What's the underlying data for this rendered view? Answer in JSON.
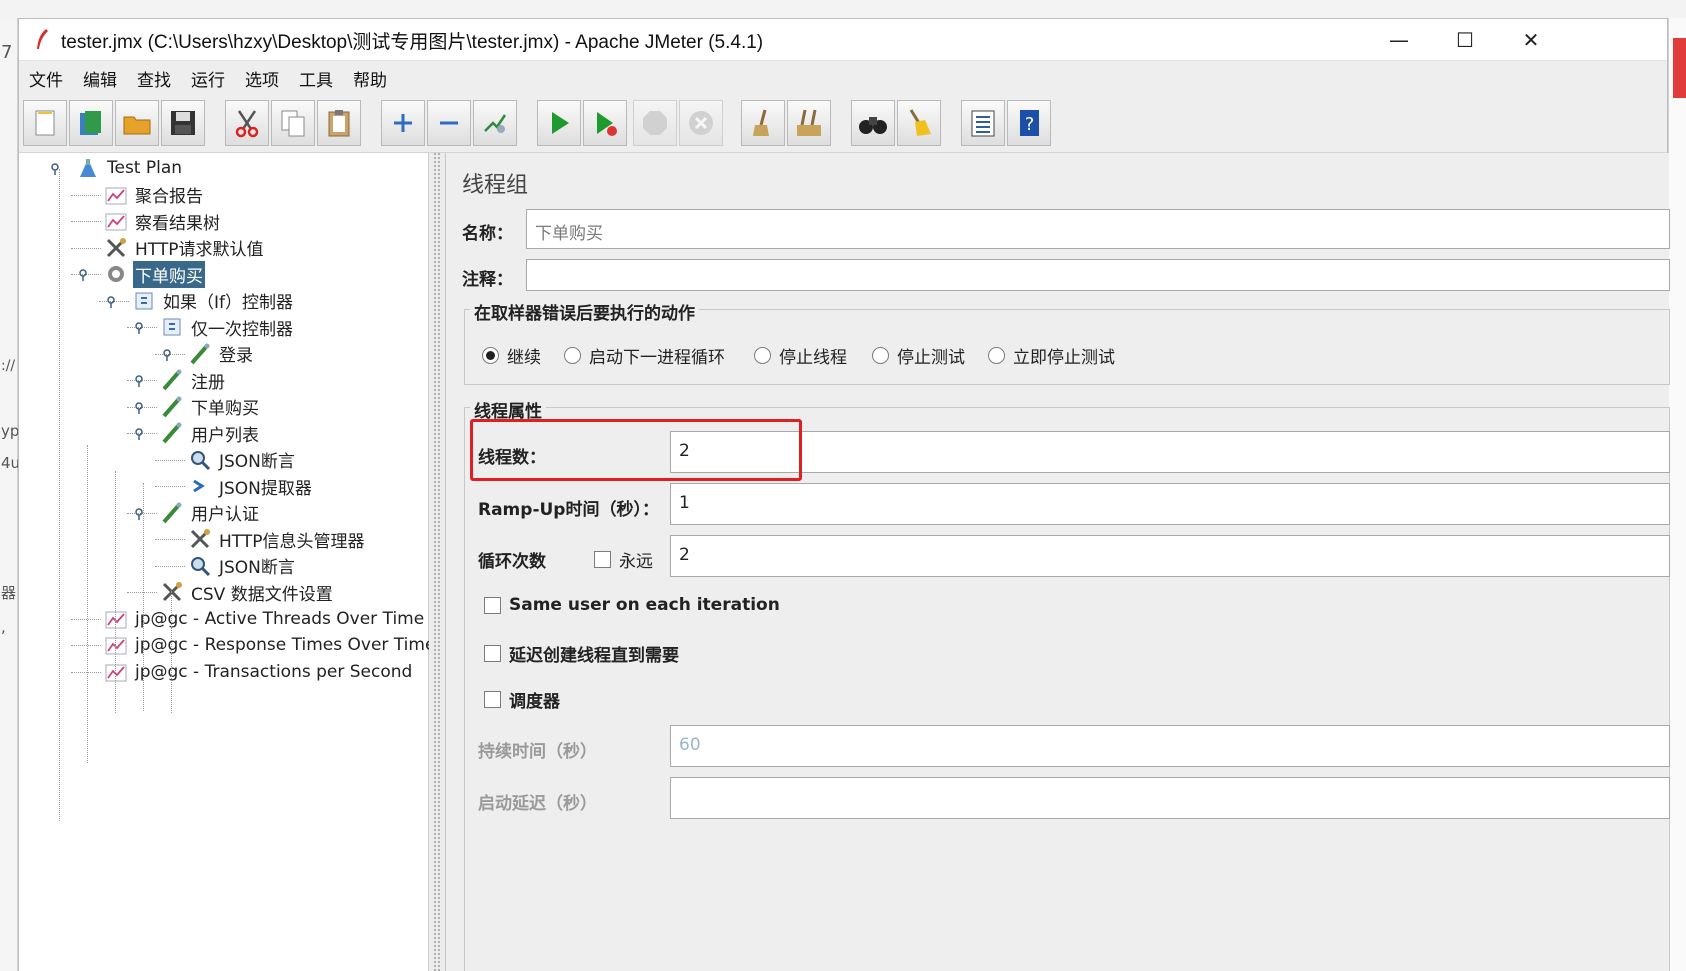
{
  "window": {
    "title": "tester.jmx (C:\\Users\\hzxy\\Desktop\\测试专用图片\\tester.jmx) - Apache JMeter (5.4.1)",
    "minimize": "—",
    "maximize": "☐",
    "close": "✕"
  },
  "background": {
    "left_chars": [
      "7",
      "://",
      "yp",
      "4u",
      "器",
      ","
    ]
  },
  "menu": [
    "文件",
    "编辑",
    "查找",
    "运行",
    "选项",
    "工具",
    "帮助"
  ],
  "toolbar": [
    {
      "icon": "new-icon"
    },
    {
      "icon": "templates-icon"
    },
    {
      "icon": "open-icon"
    },
    {
      "icon": "save-icon"
    },
    {
      "icon": "cut-icon"
    },
    {
      "icon": "copy-icon"
    },
    {
      "icon": "paste-icon"
    },
    {
      "icon": "expand-icon"
    },
    {
      "icon": "collapse-icon"
    },
    {
      "icon": "toggle-icon"
    },
    {
      "icon": "start-icon"
    },
    {
      "icon": "start-no-pauses-icon"
    },
    {
      "icon": "stop-icon"
    },
    {
      "icon": "shutdown-icon"
    },
    {
      "icon": "clear-icon"
    },
    {
      "icon": "clear-all-icon"
    },
    {
      "icon": "search-icon"
    },
    {
      "icon": "reset-search-icon"
    },
    {
      "icon": "function-helper-icon"
    },
    {
      "icon": "help-icon"
    }
  ],
  "tree": [
    {
      "label": "Test Plan",
      "icon": "test-plan-icon"
    },
    {
      "label": "聚合报告",
      "icon": "listener-icon"
    },
    {
      "label": "察看结果树",
      "icon": "listener-icon"
    },
    {
      "label": "HTTP请求默认值",
      "icon": "config-icon"
    },
    {
      "label": "下单购买",
      "icon": "thread-group-icon",
      "selected": true
    },
    {
      "label": "如果（If）控制器",
      "icon": "controller-icon"
    },
    {
      "label": "仅一次控制器",
      "icon": "controller-icon"
    },
    {
      "label": "登录",
      "icon": "sampler-icon"
    },
    {
      "label": "注册",
      "icon": "sampler-icon"
    },
    {
      "label": "下单购买",
      "icon": "sampler-icon"
    },
    {
      "label": "用户列表",
      "icon": "sampler-icon"
    },
    {
      "label": "JSON断言",
      "icon": "assertion-icon"
    },
    {
      "label": "JSON提取器",
      "icon": "extractor-icon"
    },
    {
      "label": "用户认证",
      "icon": "sampler-icon"
    },
    {
      "label": "HTTP信息头管理器",
      "icon": "config-icon"
    },
    {
      "label": "JSON断言",
      "icon": "assertion-icon"
    },
    {
      "label": "CSV 数据文件设置",
      "icon": "config-icon"
    },
    {
      "label": "jp@gc - Active Threads Over Time",
      "icon": "listener-icon"
    },
    {
      "label": "jp@gc - Response Times Over Time",
      "icon": "listener-icon"
    },
    {
      "label": "jp@gc - Transactions per Second",
      "icon": "listener-icon"
    }
  ],
  "panel": {
    "title": "线程组",
    "name_label": "名称：",
    "name_value": "下单购买",
    "comment_label": "注释：",
    "comment_value": "",
    "error_action_title": "在取样器错误后要执行的动作",
    "error_actions": [
      {
        "label": "继续",
        "checked": true
      },
      {
        "label": "启动下一进程循环",
        "checked": false
      },
      {
        "label": "停止线程",
        "checked": false
      },
      {
        "label": "停止测试",
        "checked": false
      },
      {
        "label": "立即停止测试",
        "checked": false
      }
    ],
    "thread_props_title": "线程属性",
    "threads_label": "线程数：",
    "threads_value": "2",
    "rampup_label": "Ramp-Up时间（秒）：",
    "rampup_value": "1",
    "loop_label": "循环次数",
    "forever_label": "永远",
    "loop_value": "2",
    "same_user_label": "Same user on each iteration",
    "delay_create_label": "延迟创建线程直到需要",
    "scheduler_label": "调度器",
    "duration_label": "持续时间（秒）",
    "duration_value": "60",
    "startup_delay_label": "启动延迟（秒）",
    "startup_delay_value": ""
  },
  "colors": {
    "selection": "#39698a",
    "highlight": "#e02020"
  }
}
